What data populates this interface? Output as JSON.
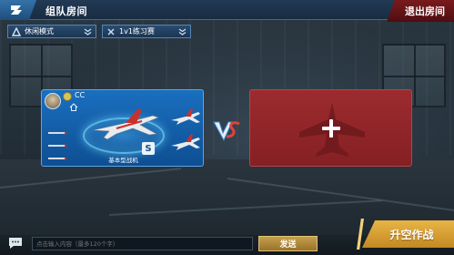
{
  "header": {
    "title": "组队房间",
    "exit_label": "退出房间"
  },
  "selectors": {
    "mode": "休闲模式",
    "match": "1v1练习赛"
  },
  "player": {
    "name": "CC",
    "plane_name": "基本型战机",
    "badge": "S"
  },
  "chat": {
    "placeholder": "点击输入内容（最多120个字）",
    "send_label": "发送"
  },
  "actions": {
    "takeoff_label": "升空作战"
  },
  "colors": {
    "player_card": "#1a6fbf",
    "empty_slot": "#9c2b2e",
    "accent_gold": "#e8b546",
    "exit_red": "#7a1a1c"
  }
}
